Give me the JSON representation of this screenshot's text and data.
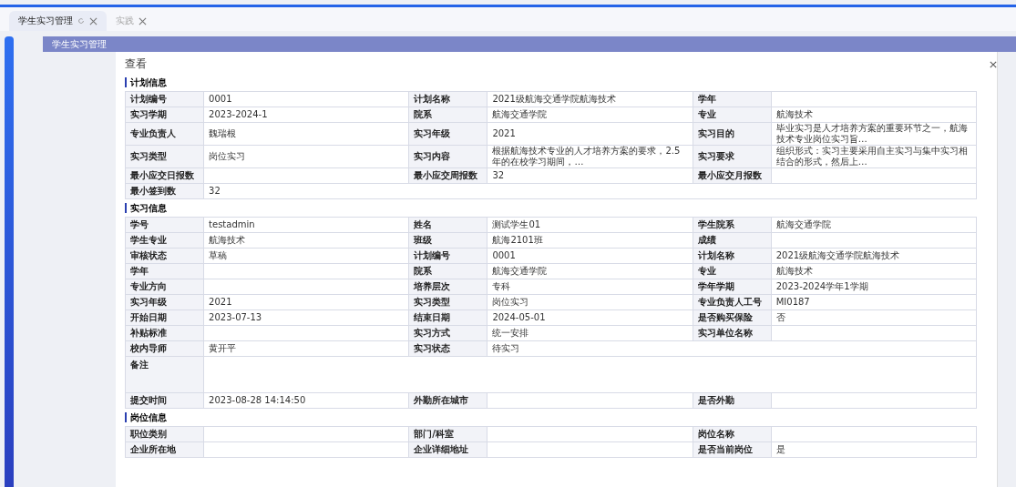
{
  "tabs": [
    {
      "label": "学生实习管理",
      "selected": true
    },
    {
      "label": "实践",
      "selected": false
    }
  ],
  "page_header": {
    "title": "学生实习管理"
  },
  "dialog": {
    "title": "查看",
    "sections": [
      {
        "title": "计划信息",
        "rows": [
          {
            "kind": "normal",
            "fields": [
              {
                "label": "计划编号",
                "value": "0001"
              },
              {
                "label": "计划名称",
                "value": "2021级航海交通学院航海技术"
              },
              {
                "label": "学年"
              }
            ]
          },
          {
            "kind": "normal",
            "fields": [
              {
                "label": "实习学期",
                "value": "2023-2024-1"
              },
              {
                "label": "院系",
                "value": "航海交通学院"
              },
              {
                "label": "专业",
                "value": "航海技术"
              }
            ]
          },
          {
            "kind": "normal",
            "fields": [
              {
                "label": "专业负责人",
                "value": "魏瑞根"
              },
              {
                "label": "实习年级",
                "value": "2021"
              },
              {
                "label": "实习目的",
                "value": "毕业实习是人才培养方案的重要环节之一，航海技术专业岗位实习旨…"
              }
            ]
          },
          {
            "kind": "normal",
            "fields": [
              {
                "label": "实习类型",
                "value": "岗位实习"
              },
              {
                "label": "实习内容",
                "value": "根据航海技术专业的人才培养方案的要求，2.5年的在校学习期间，…"
              },
              {
                "label": "实习要求",
                "value": "组织形式：实习主要采用自主实习与集中实习相结合的形式，然后上…"
              }
            ]
          },
          {
            "kind": "normal",
            "fields": [
              {
                "label": "最小应交日报数"
              },
              {
                "label": "最小应交周报数",
                "value": "32"
              },
              {
                "label": "最小应交月报数"
              }
            ]
          },
          {
            "kind": "normal",
            "fields": [
              {
                "label": "最小签到数",
                "value": "32"
              }
            ]
          }
        ]
      },
      {
        "title": "实习信息",
        "rows": [
          {
            "kind": "normal",
            "fields": [
              {
                "label": "学号",
                "value": "testadmin"
              },
              {
                "label": "姓名",
                "value": "测试学生01"
              },
              {
                "label": "学生院系",
                "value": "航海交通学院"
              }
            ]
          },
          {
            "kind": "normal",
            "fields": [
              {
                "label": "学生专业",
                "value": "航海技术"
              },
              {
                "label": "班级",
                "value": "航海2101班"
              },
              {
                "label": "成绩"
              }
            ]
          },
          {
            "kind": "normal",
            "fields": [
              {
                "label": "审核状态",
                "value": "草稿"
              },
              {
                "label": "计划编号",
                "value": "0001"
              },
              {
                "label": "计划名称",
                "value": "2021级航海交通学院航海技术"
              }
            ]
          },
          {
            "kind": "normal",
            "fields": [
              {
                "label": "学年"
              },
              {
                "label": "院系",
                "value": "航海交通学院"
              },
              {
                "label": "专业",
                "value": "航海技术"
              }
            ]
          },
          {
            "kind": "normal",
            "fields": [
              {
                "label": "专业方向"
              },
              {
                "label": "培养层次",
                "value": "专科"
              },
              {
                "label": "学年学期",
                "value": "2023-2024学年1学期"
              }
            ]
          },
          {
            "kind": "normal",
            "fields": [
              {
                "label": "实习年级",
                "value": "2021"
              },
              {
                "label": "实习类型",
                "value": "岗位实习"
              },
              {
                "label": "专业负责人工号",
                "value": "MI0187"
              }
            ]
          },
          {
            "kind": "normal",
            "fields": [
              {
                "label": "开始日期",
                "value": "2023-07-13"
              },
              {
                "label": "结束日期",
                "value": "2024-05-01"
              },
              {
                "label": "是否购买保险",
                "value": "否"
              }
            ]
          },
          {
            "kind": "normal",
            "fields": [
              {
                "label": "补贴标准"
              },
              {
                "label": "实习方式",
                "value": "统一安排"
              },
              {
                "label": "实习单位名称"
              }
            ]
          },
          {
            "kind": "normal",
            "fields": [
              {
                "label": "校内导师",
                "value": "黄开平"
              },
              {
                "label": "实习状态",
                "value": "待实习"
              }
            ]
          },
          {
            "kind": "tall",
            "fields": [
              {
                "label": "备注"
              }
            ]
          },
          {
            "kind": "normal",
            "fields": [
              {
                "label": "提交时间",
                "value": "2023-08-28 14:14:50"
              },
              {
                "label": "外勤所在城市"
              },
              {
                "label": "是否外勤"
              }
            ]
          }
        ]
      },
      {
        "title": "岗位信息",
        "rows": [
          {
            "kind": "normal",
            "fields": [
              {
                "label": "职位类别"
              },
              {
                "label": "部门/科室"
              },
              {
                "label": "岗位名称"
              }
            ]
          },
          {
            "kind": "normal",
            "fields": [
              {
                "label": "企业所在地"
              },
              {
                "label": "企业详细地址"
              },
              {
                "label": "是否当前岗位",
                "value": "是"
              }
            ]
          }
        ]
      }
    ]
  }
}
